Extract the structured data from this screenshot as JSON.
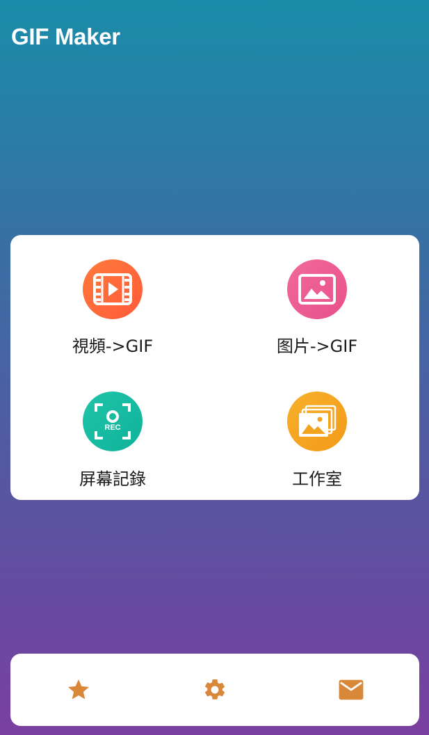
{
  "header": {
    "title": "GIF Maker"
  },
  "menu": {
    "items": [
      {
        "label": "視頻->GIF",
        "icon": "video-icon",
        "color_start": "#ff7a3a",
        "color_end": "#ff5a3a"
      },
      {
        "label": "图片->GIF",
        "icon": "image-icon",
        "color_start": "#f06a9a",
        "color_end": "#e8508a"
      },
      {
        "label": "屏幕記錄",
        "icon": "screen-record-icon",
        "color_start": "#1ec3a8",
        "color_end": "#10b39a"
      },
      {
        "label": "工作室",
        "icon": "gallery-icon",
        "color_start": "#f7b02a",
        "color_end": "#f39a1a"
      }
    ]
  },
  "bottom_bar": {
    "accent": "#d9883a",
    "items": [
      {
        "icon": "star-icon"
      },
      {
        "icon": "gear-icon"
      },
      {
        "icon": "mail-icon"
      }
    ]
  }
}
